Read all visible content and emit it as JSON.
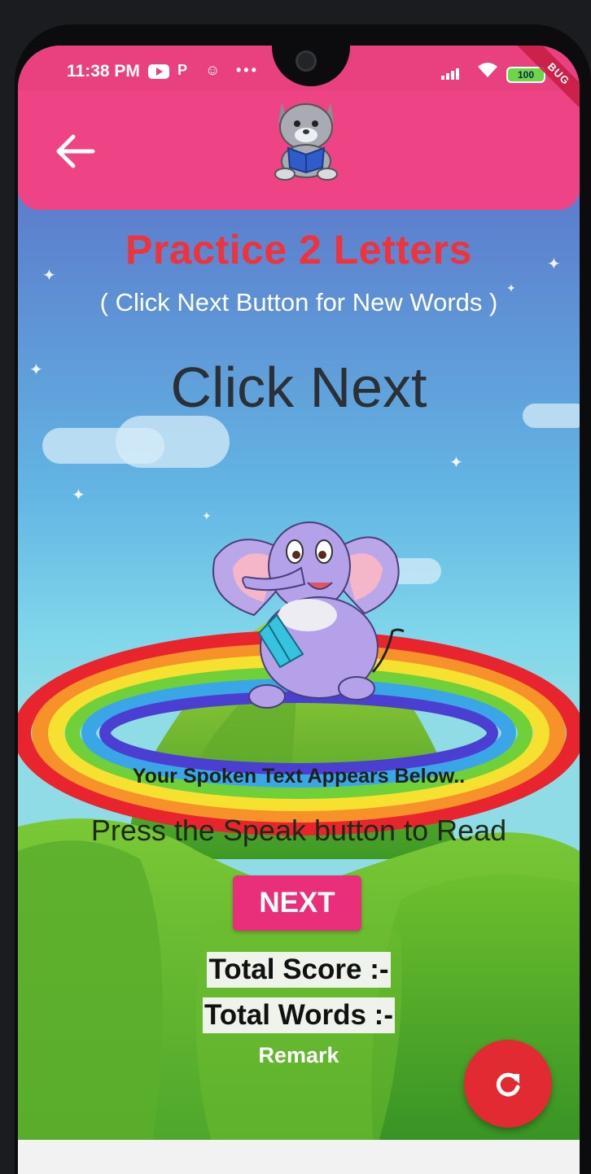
{
  "status_bar": {
    "time": "11:38 PM",
    "icons": [
      "youtube-icon",
      "p-icon",
      "cat-app-icon",
      "more-dots-icon",
      "signal-icon",
      "wifi-icon"
    ],
    "battery": "100",
    "debug_label": "BUG"
  },
  "app_bar": {
    "back_icon": "arrow-left-icon",
    "logo": "reading-cat-logo"
  },
  "practice": {
    "title": "Practice 2 Letters",
    "subtitle": "( Click Next Button for New Words )",
    "word": "Click Next"
  },
  "spoken": {
    "heading": "Your Spoken Text Appears Below..",
    "text": "Press the Speak button to Read"
  },
  "controls": {
    "next_label": "NEXT",
    "reset_icon": "refresh-icon"
  },
  "scores": {
    "total_score": "Total Score :-",
    "total_words": "Total Words :-",
    "remark": "Remark"
  },
  "colors": {
    "accent_pink": "#ee4486",
    "title_red": "#f0323b",
    "fab_red": "#e12a32"
  }
}
